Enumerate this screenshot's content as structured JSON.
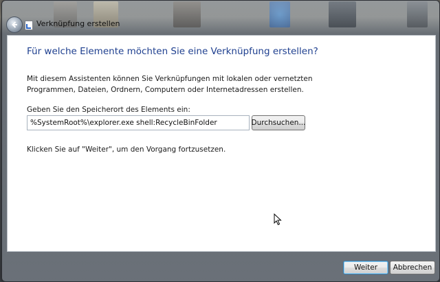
{
  "window": {
    "title": "Verknüpfung erstellen"
  },
  "wizard": {
    "heading": "Für welche Elemente möchten Sie eine Verknüpfung erstellen?",
    "description": "Mit diesem Assistenten können Sie Verknüpfungen mit lokalen oder vernetzten Programmen, Dateien, Ordnern, Computern oder Internetadressen erstellen.",
    "location_label": "Geben Sie den Speicherort des Elements ein:",
    "location_value": "%SystemRoot%\\explorer.exe shell:RecycleBinFolder",
    "browse_label": "Durchsuchen...",
    "hint": "Klicken Sie auf \"Weiter\", um den Vorgang fortzusetzen."
  },
  "footer": {
    "next_label": "Weiter",
    "cancel_label": "Abbrechen"
  },
  "icons": {
    "back": "back-arrow-icon",
    "app": "shortcut-icon",
    "cursor": "mouse-pointer-icon"
  },
  "colors": {
    "heading": "#1e3f8f",
    "default_button_border": "#3c7fb1"
  }
}
